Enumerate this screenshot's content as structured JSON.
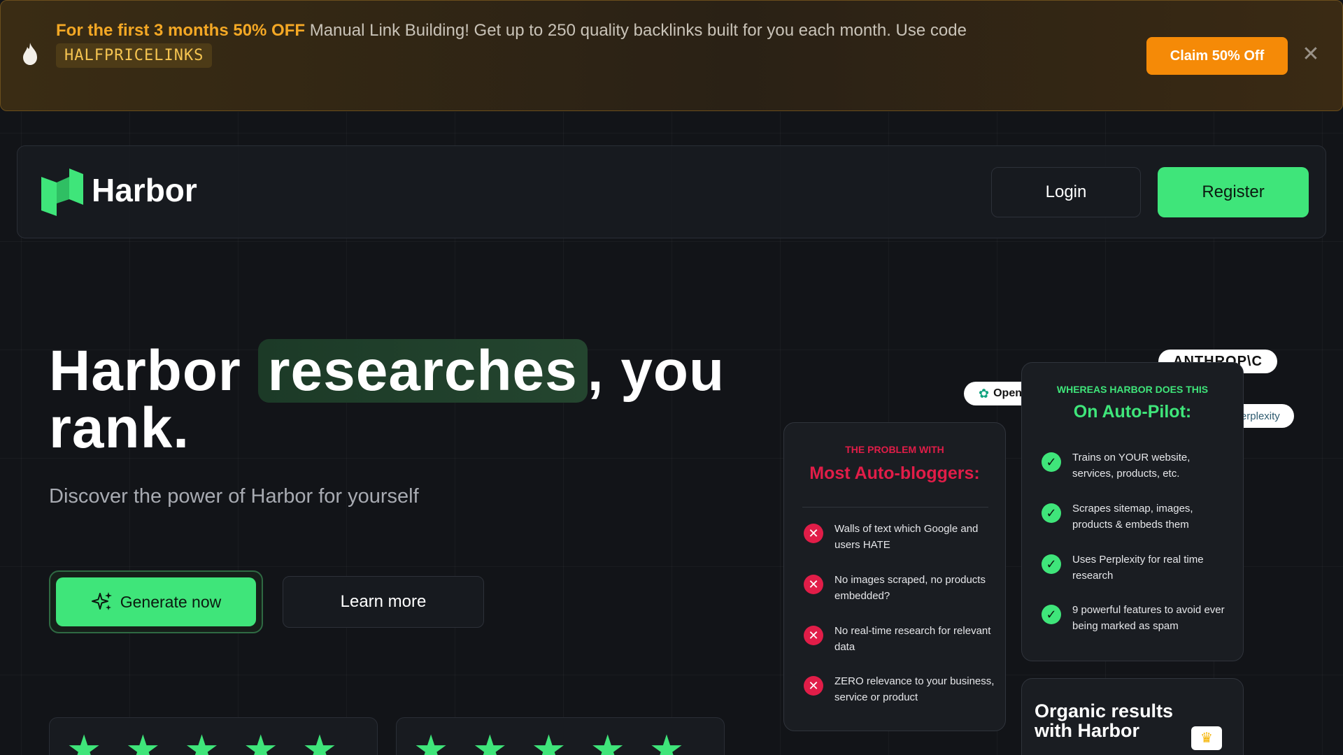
{
  "banner": {
    "highlight": "For the first 3 months 50% OFF",
    "message": " Manual Link Building! Get up to 250 quality backlinks built for you each month. Use code",
    "code": "HALFPRICELINKS",
    "cta": "Claim 50% Off",
    "close": "✕"
  },
  "nav": {
    "brand": "Harbor",
    "login": "Login",
    "register": "Register"
  },
  "hero": {
    "title_before": "Harbor ",
    "title_highlight": "researches",
    "title_after": ", you rank.",
    "subtitle": "Discover the power of Harbor for yourself",
    "generate": "Generate now",
    "learn": "Learn more"
  },
  "ratings": [
    {
      "stars": 5
    },
    {
      "stars": 5
    }
  ],
  "problem": {
    "kicker": "THE PROBLEM WITH",
    "heading": "Most Auto-bloggers:",
    "items": [
      "Walls of text which Google and users HATE",
      "No images scraped, no products embedded?",
      "No real-time research for relevant data",
      "ZERO relevance to your business, service or product"
    ]
  },
  "solution": {
    "kicker": "WHEREAS HARBOR DOES THIS",
    "heading": "On Auto-Pilot:",
    "items": [
      "Trains on YOUR website, services, products, etc.",
      "Scrapes sitemap, images, products & embeds them",
      "Uses Perplexity for real time research",
      "9 powerful features to avoid ever being marked as spam"
    ]
  },
  "organic": {
    "text": "Organic results with Harbor"
  },
  "chips": {
    "openai": "OpenAI",
    "anthropic": "ANTHROP\\C",
    "perplexity": "perplexity"
  },
  "colors": {
    "accent_green": "#3fe57a",
    "problem_red": "#e11d48",
    "promo_orange": "#f58a07"
  }
}
